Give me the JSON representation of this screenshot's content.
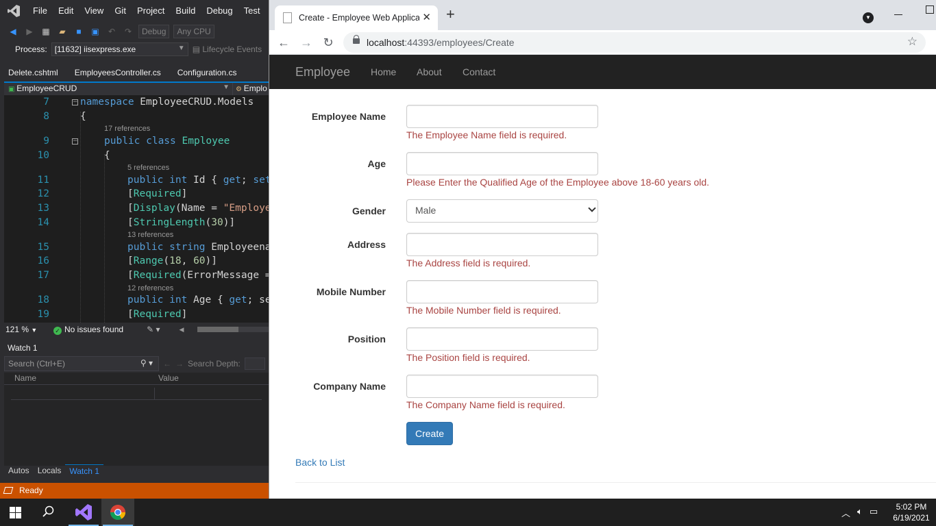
{
  "vs": {
    "menu": [
      "File",
      "Edit",
      "View",
      "Git",
      "Project",
      "Build",
      "Debug",
      "Test"
    ],
    "toolbar": {
      "config": "Debug",
      "platform": "Any CPU"
    },
    "process_label": "Process:",
    "process_value": "[11632] iisexpress.exe",
    "lifecycle": "Lifecycle Events",
    "tabs": [
      "Delete.cshtml",
      "EmployeesController.cs",
      "Configuration.cs"
    ],
    "nav_left": "EmployeeCRUD",
    "nav_right": "Emplo",
    "code": {
      "l7": {
        "n": "7",
        "kw": "namespace",
        "rest": " EmployeeCRUD.Models"
      },
      "l8": {
        "n": "8",
        "text": "{"
      },
      "r9": "17 references",
      "l9": {
        "n": "9",
        "kw": "public class",
        "ty": "Employee"
      },
      "l10": {
        "n": "10",
        "text": "{"
      },
      "r11": "5 references",
      "l11": {
        "n": "11",
        "kw": "public int",
        "rest": " Id { ",
        "kw2": "get",
        "rest2": "; ",
        "kw3": "set"
      },
      "l12": {
        "n": "12",
        "p1": "[",
        "ty": "Required",
        "p2": "]"
      },
      "l13": {
        "n": "13",
        "p1": "[",
        "ty": "Display",
        "p2": "(Name = ",
        "st": "\"Employe"
      },
      "l14": {
        "n": "14",
        "p1": "[",
        "ty": "StringLength",
        "p2": "(",
        "nu": "30",
        "p3": ")]"
      },
      "r15": "13 references",
      "l15": {
        "n": "15",
        "kw": "public string",
        "rest": " Employeena"
      },
      "l16": {
        "n": "16",
        "p1": "[",
        "ty": "Range",
        "p2": "(",
        "nu": "18",
        "p3": ", ",
        "nu2": "60",
        "p4": ")]"
      },
      "l17": {
        "n": "17",
        "p1": "[",
        "ty": "Required",
        "p2": "(ErrorMessage ="
      },
      "r18": "12 references",
      "l18": {
        "n": "18",
        "kw": "public int",
        "rest": " Age { ",
        "kw2": "get",
        "rest2": "; se"
      },
      "l19": {
        "n": "19",
        "p1": "[",
        "ty": "Required",
        "p2": "]"
      }
    },
    "zoom": "121 %",
    "issues": "No issues found",
    "watch_title": "Watch 1",
    "watch_search_placeholder": "Search (Ctrl+E)",
    "search_depth": "Search Depth:",
    "watch_cols": [
      "Name",
      "Value"
    ],
    "bottom_tabs": [
      "Autos",
      "Locals",
      "Watch 1"
    ],
    "status": "Ready"
  },
  "chrome": {
    "tab_title": "Create - Employee Web Application",
    "url_host": "localhost",
    "url_rest": ":44393/employees/Create"
  },
  "site": {
    "brand": "Employee",
    "nav": [
      "Home",
      "About",
      "Contact"
    ],
    "fields": [
      {
        "label": "Employee Name",
        "error": "The Employee Name field is required."
      },
      {
        "label": "Age",
        "error": "Please Enter the Qualified Age of the Employee above 18-60 years old."
      },
      {
        "label": "Gender",
        "value": "Male"
      },
      {
        "label": "Address",
        "error": "The Address field is required."
      },
      {
        "label": "Mobile Number",
        "error": "The Mobile Number field is required."
      },
      {
        "label": "Position",
        "error": "The Position field is required."
      },
      {
        "label": "Company Name",
        "error": "The Company Name field is required."
      }
    ],
    "create_button": "Create",
    "back_link": "Back to List"
  },
  "taskbar": {
    "time": "5:02 PM",
    "date": "6/19/2021"
  },
  "colors": {
    "vs_accent": "#007acc",
    "vs_status": "#ca5100",
    "error": "#a94442",
    "primary": "#337ab7"
  }
}
